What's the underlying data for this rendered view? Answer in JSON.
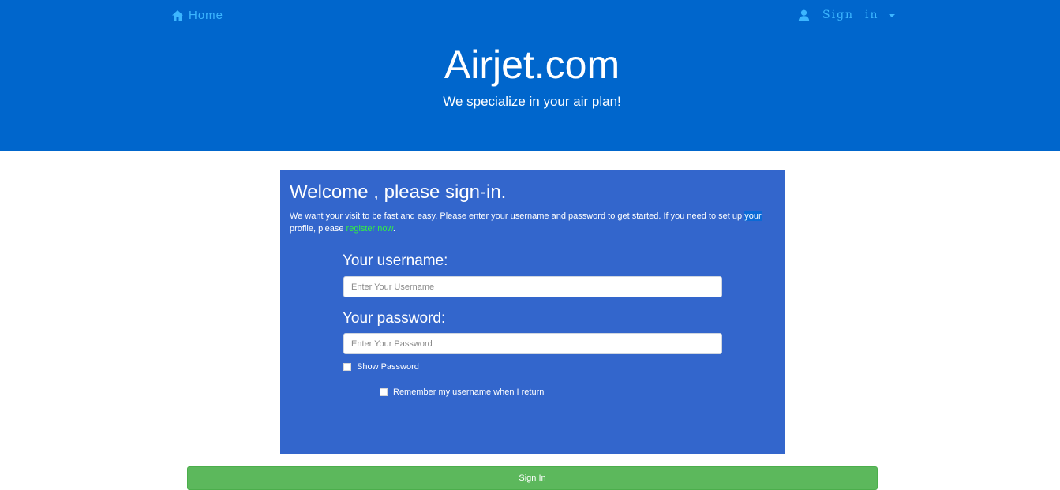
{
  "nav": {
    "home_label": "Home",
    "signin_word1": "Sign",
    "signin_word2": "in"
  },
  "hero": {
    "title": "Airjet.com",
    "tagline": "We specialize in your air plan!"
  },
  "login": {
    "heading": "Welcome , please sign-in.",
    "intro_part1": "We want your visit to be fast and easy. Please enter your username and password to get started. If you need to set up ",
    "intro_highlight": "your",
    "intro_part2": " profile, please ",
    "register_link": "register now",
    "intro_end": ".",
    "username_label": "Your username:",
    "username_placeholder": "Enter Your Username",
    "username_value": "",
    "password_label": "Your password:",
    "password_placeholder": "Enter Your Password",
    "password_value": "",
    "show_password_label": "Show Password",
    "show_password_checked": false,
    "remember_label": "Remember my username when I return",
    "remember_checked": false,
    "submit_label": "Sign In"
  },
  "colors": {
    "hero_bg": "#0066cc",
    "panel_bg": "#3366cc",
    "nav_link": "#3cb6ff",
    "register_link": "#33ee44",
    "submit_bg": "#5cb85c"
  },
  "icons": {
    "home": "home-icon",
    "user": "user-icon",
    "caret": "caret-down-icon"
  }
}
